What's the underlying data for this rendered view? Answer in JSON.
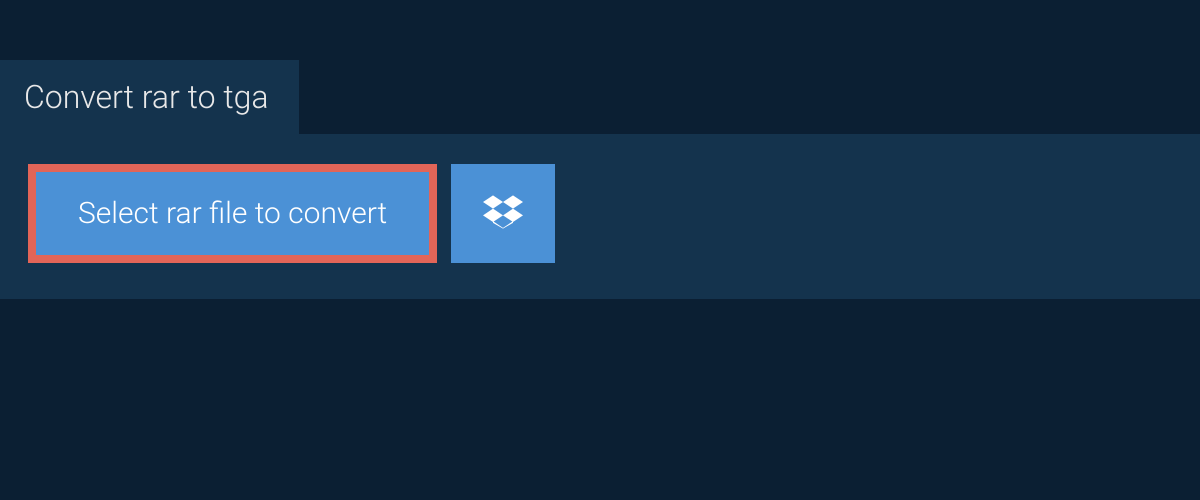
{
  "tab": {
    "label": "Convert rar to tga"
  },
  "buttons": {
    "select_file_label": "Select rar file to convert"
  },
  "colors": {
    "background": "#0b1f33",
    "panel": "#14334d",
    "button": "#4b91d6",
    "highlight_border": "#e26558",
    "text_light": "#ffffff"
  }
}
